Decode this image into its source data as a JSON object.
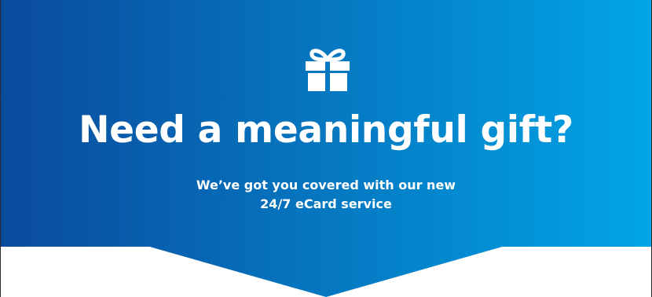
{
  "banner": {
    "icon": "gift-icon",
    "headline": "Need a meaningful gift?",
    "subline_1": "We’ve got you covered with our new",
    "subline_2": "24/7 eCard service",
    "gradient_start": "#0a4a9c",
    "gradient_end": "#01a5e6",
    "text_color": "#ffffff",
    "background_below": "#ffffff"
  }
}
